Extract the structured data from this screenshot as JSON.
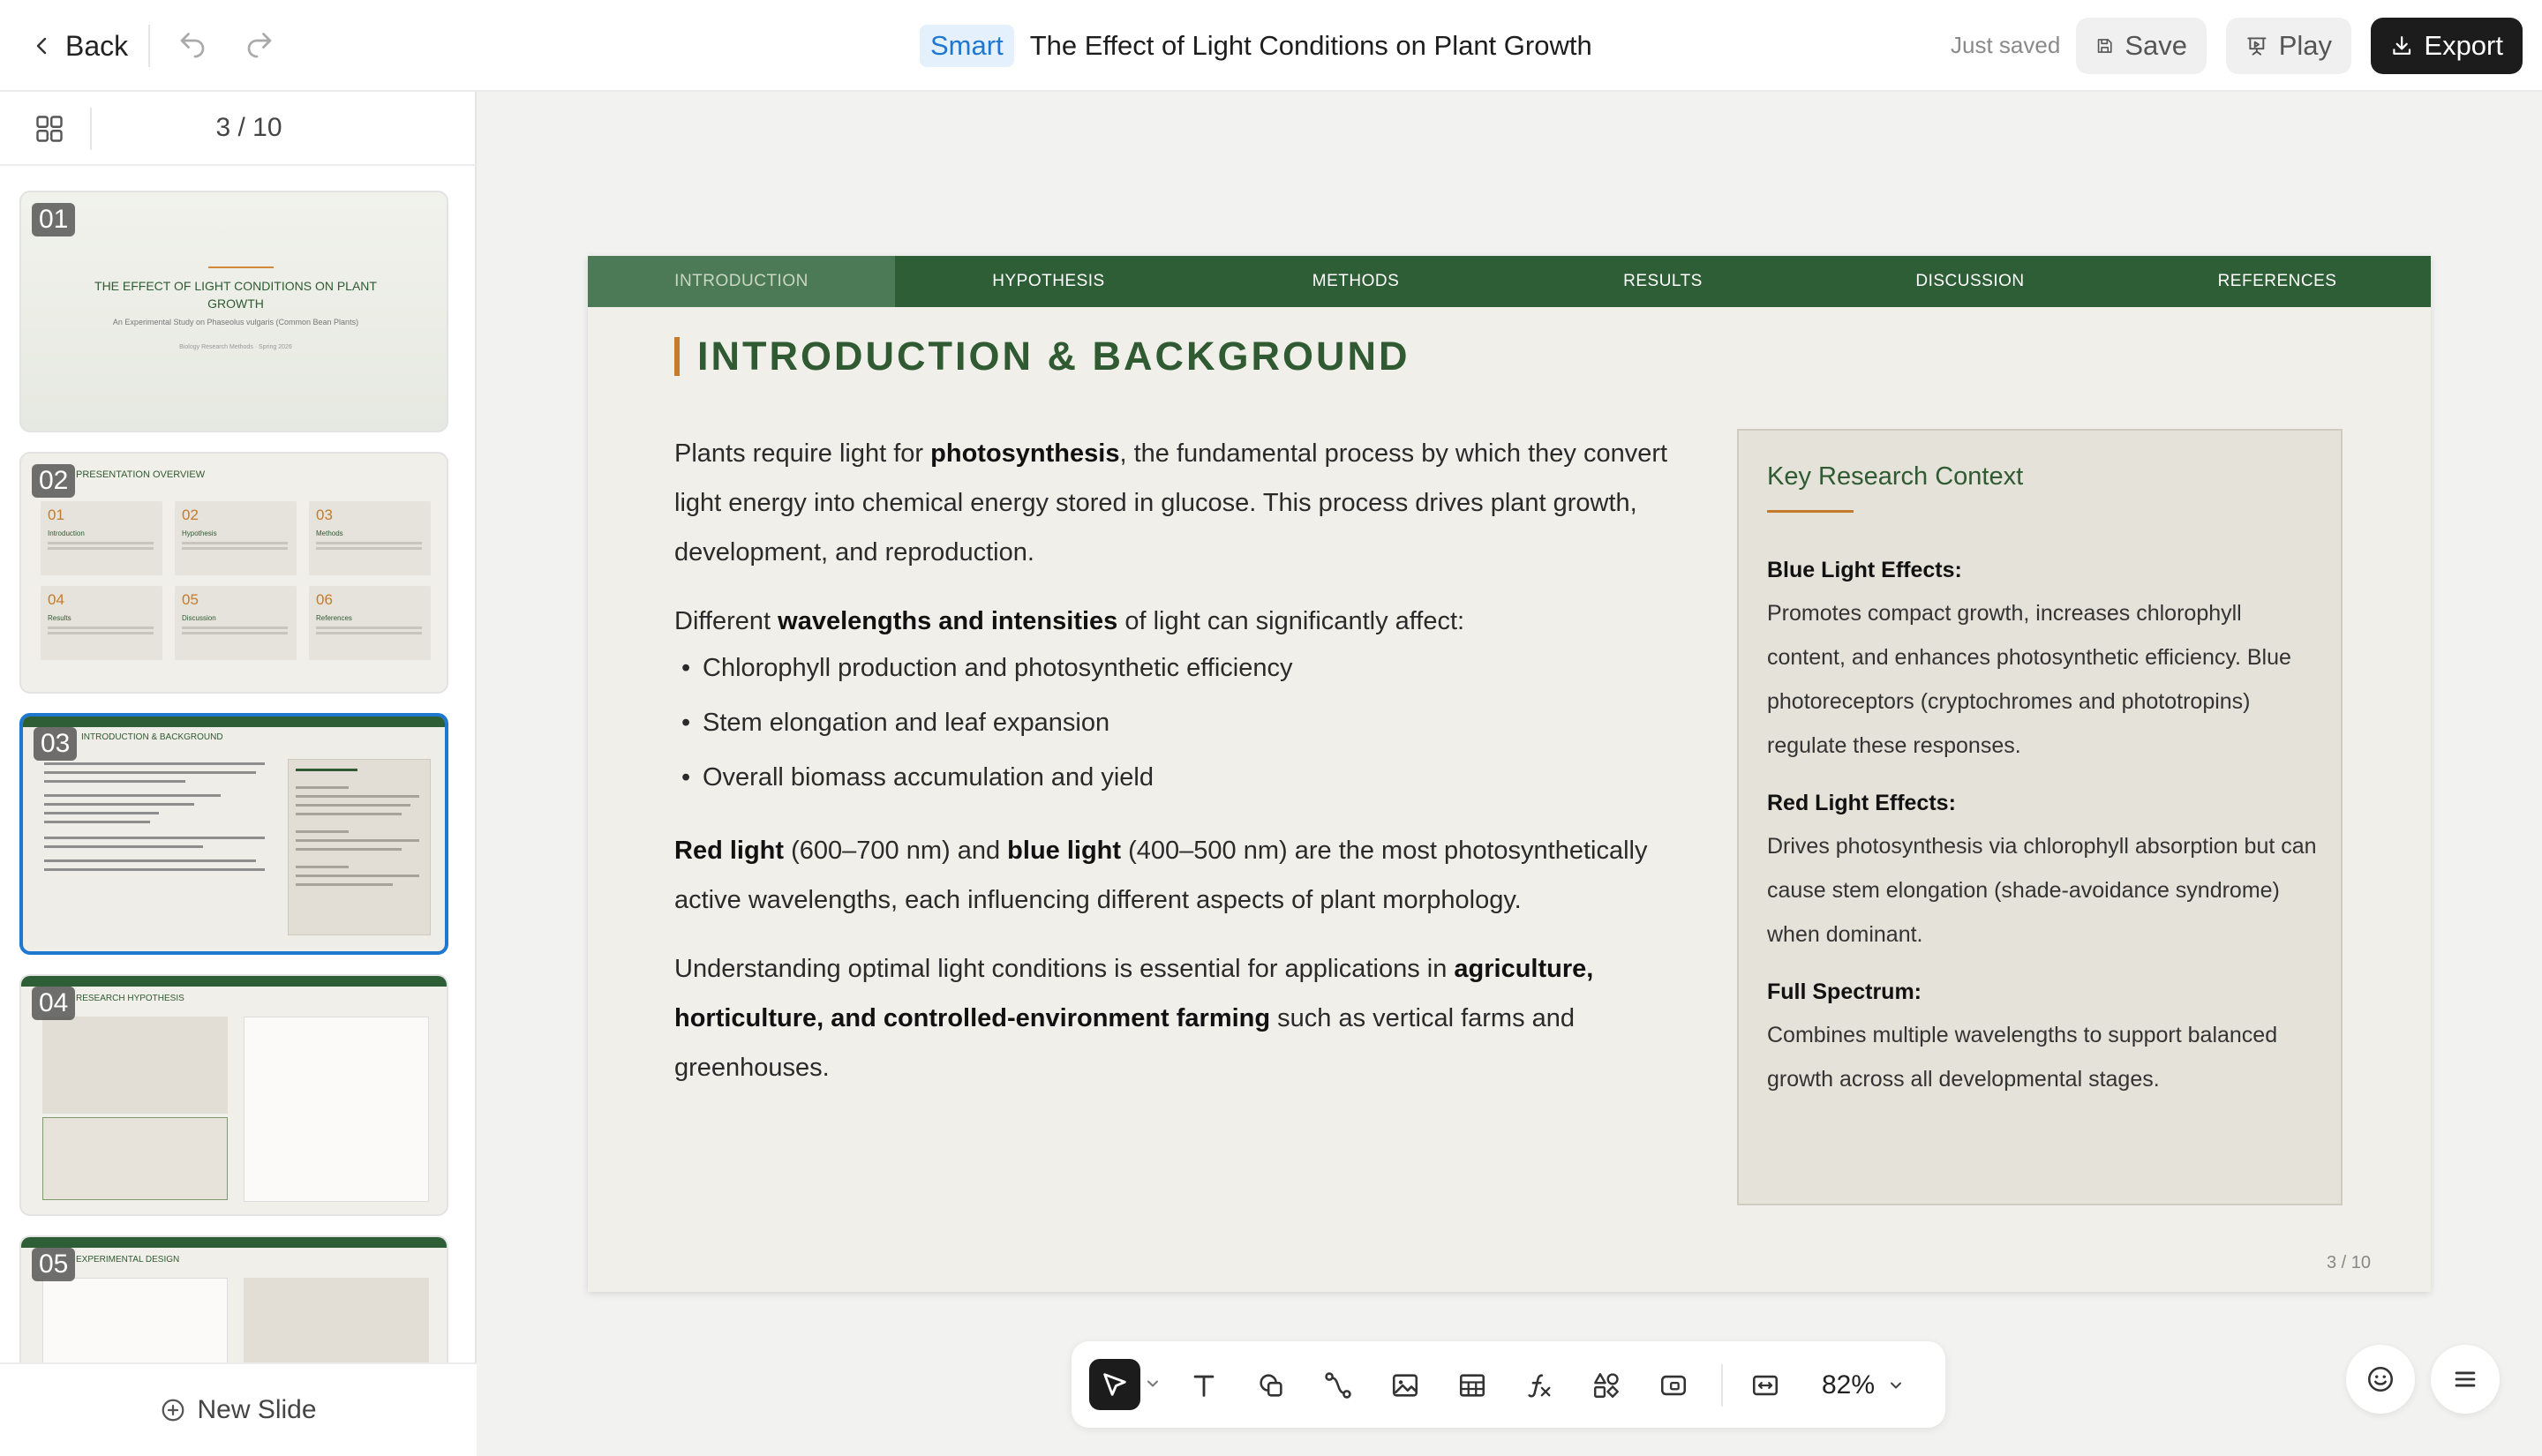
{
  "topbar": {
    "back_label": "Back",
    "smart_badge": "Smart",
    "doc_title": "The Effect of Light Conditions on Plant Growth",
    "saved_status": "Just saved",
    "save_label": "Save",
    "play_label": "Play",
    "export_label": "Export"
  },
  "sidebar": {
    "page_counter": "3 / 10",
    "new_slide_label": "New Slide",
    "thumbnails": [
      {
        "num": "01",
        "title": "THE EFFECT OF LIGHT CONDITIONS ON PLANT GROWTH",
        "subtitle": "An Experimental Study on Phaseolus vulgaris (Common Bean Plants)",
        "meta": "Biology Research Methods · Spring 2026"
      },
      {
        "num": "02",
        "title": "PRESENTATION OVERVIEW",
        "cells": [
          {
            "n": "01",
            "label": "Introduction"
          },
          {
            "n": "02",
            "label": "Hypothesis"
          },
          {
            "n": "03",
            "label": "Methods"
          },
          {
            "n": "04",
            "label": "Results"
          },
          {
            "n": "05",
            "label": "Discussion"
          },
          {
            "n": "06",
            "label": "References"
          }
        ]
      },
      {
        "num": "03",
        "title": "INTRODUCTION & BACKGROUND",
        "box_title": "Key Research Context"
      },
      {
        "num": "04",
        "title": "RESEARCH HYPOTHESIS"
      },
      {
        "num": "05",
        "title": "EXPERIMENTAL DESIGN"
      }
    ]
  },
  "slide": {
    "nav_tabs": [
      "INTRODUCTION",
      "HYPOTHESIS",
      "METHODS",
      "RESULTS",
      "DISCUSSION",
      "REFERENCES"
    ],
    "active_tab": "INTRODUCTION",
    "heading": "INTRODUCTION & BACKGROUND",
    "para1_a": "Plants require light for ",
    "para1_b": "photosynthesis",
    "para1_c": ", the fundamental process by which they convert light energy into chemical energy stored in glucose. This process drives plant growth, development, and reproduction.",
    "para2_a": "Different ",
    "para2_b": "wavelengths and intensities",
    "para2_c": " of light can significantly affect:",
    "bullets": [
      "Chlorophyll production and photosynthetic efficiency",
      "Stem elongation and leaf expansion",
      "Overall biomass accumulation and yield"
    ],
    "para3_a": "Red light",
    "para3_b": " (600–700 nm) and ",
    "para3_c": "blue light",
    "para3_d": " (400–500 nm) are the most photosynthetically active wavelengths, each influencing different aspects of plant morphology.",
    "para4_a": "Understanding optimal light conditions is essential for applications in ",
    "para4_b": "agriculture, horticulture, and controlled-environment farming",
    "para4_c": " such as vertical farms and greenhouses.",
    "context": {
      "title": "Key Research Context",
      "blue_h": "Blue Light Effects:",
      "blue_p": "Promotes compact growth, increases chlorophyll content, and enhances photosynthetic efficiency. Blue photoreceptors (cryptochromes and phototropins) regulate these responses.",
      "red_h": "Red Light Effects:",
      "red_p": "Drives photosynthesis via chlorophyll absorption but can cause stem elongation (shade-avoidance syndrome) when dominant.",
      "full_h": "Full Spectrum:",
      "full_p": "Combines multiple wavelengths to support balanced growth across all developmental stages."
    },
    "page_number": "3 / 10"
  },
  "toolbar": {
    "zoom_level": "82%",
    "tools": [
      "select-tool",
      "text-tool",
      "shape-tool",
      "connector-tool",
      "image-tool",
      "table-tool",
      "formula-tool",
      "components-tool",
      "media-tool",
      "fit-tool"
    ]
  },
  "colors": {
    "accent_green": "#2e5e36",
    "accent_orange": "#c47b2c",
    "active_blue": "#1e78d0"
  }
}
